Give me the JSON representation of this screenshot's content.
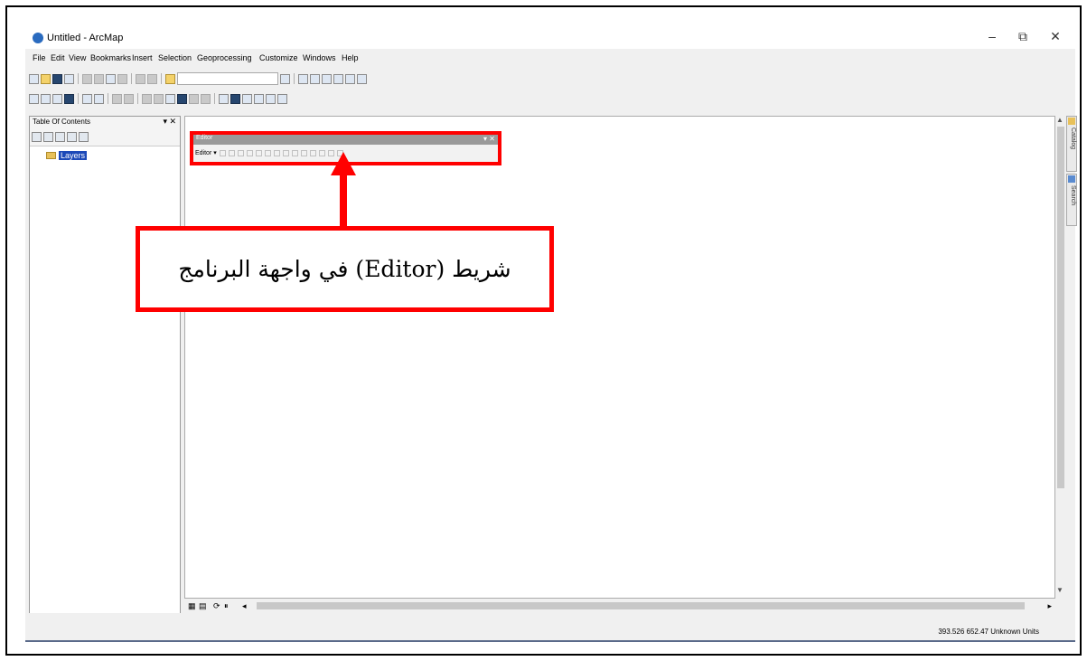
{
  "window": {
    "title": "Untitled - ArcMap",
    "minimize": "–",
    "maximize": "⧉",
    "close": "✕"
  },
  "menu": [
    "File",
    "Edit",
    "View",
    "Bookmarks",
    "Insert",
    "Selection",
    "Geoprocessing",
    "Customize",
    "Windows",
    "Help"
  ],
  "toc": {
    "title": "Table Of Contents",
    "pin": "▾ ✕",
    "layers_label": "Layers"
  },
  "editor_toolbar": {
    "title": "Editor",
    "menu_label": "Editor ▾",
    "close": "▾ ✕"
  },
  "side_tabs": {
    "catalog": "Catalog",
    "search": "Search"
  },
  "status": {
    "coordinates": "393.526  652.47 Unknown Units"
  },
  "annotation": {
    "text": "شريط (Editor) في واجهة البرنامج",
    "color": "#ff0000"
  }
}
